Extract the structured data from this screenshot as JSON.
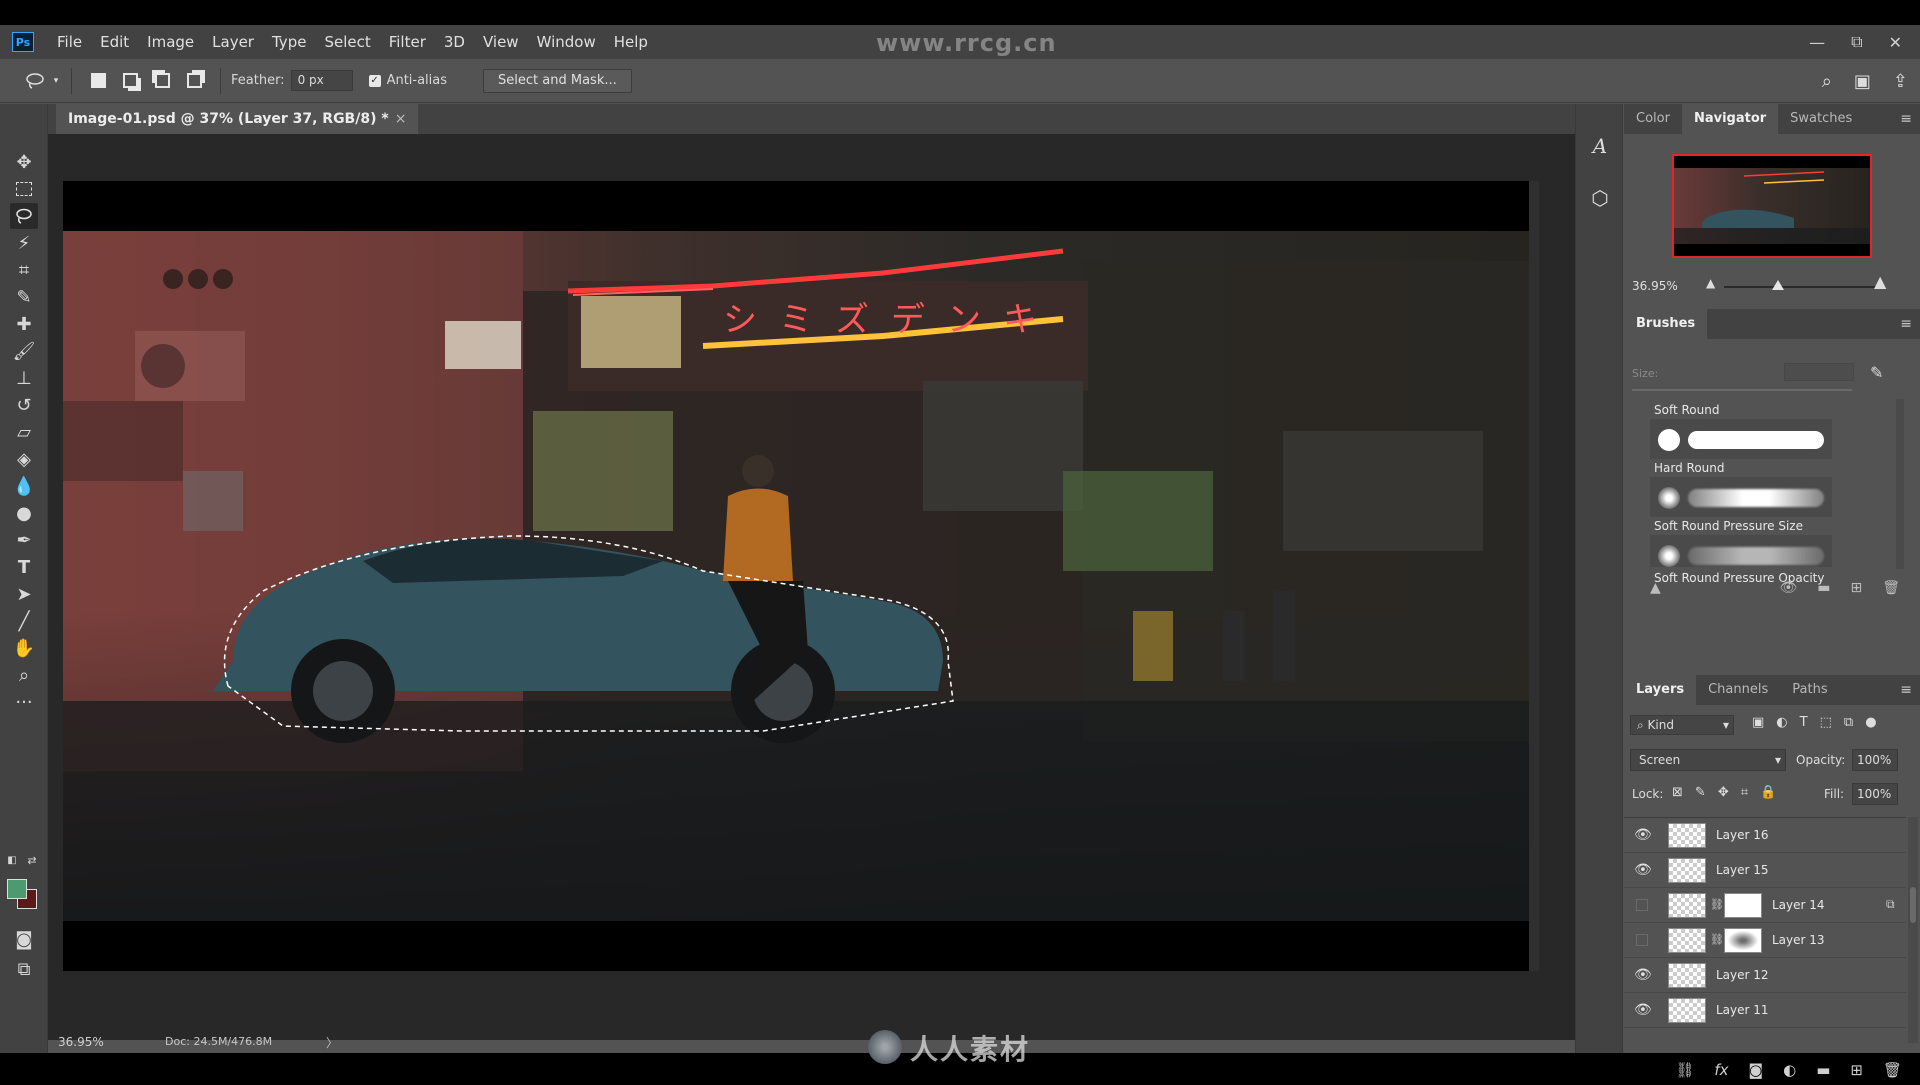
{
  "app": {
    "logo": "Ps",
    "watermark_top": "www.rrcg.cn",
    "watermark_bottom": "人人素材"
  },
  "menu": [
    "File",
    "Edit",
    "Image",
    "Layer",
    "Type",
    "Select",
    "Filter",
    "3D",
    "View",
    "Window",
    "Help"
  ],
  "window_controls": {
    "minimize": "—",
    "restore": "⧉",
    "close": "✕"
  },
  "options_bar": {
    "feather_label": "Feather:",
    "feather_value": "0 px",
    "anti_alias_label": "Anti-alias",
    "anti_alias_checked": true,
    "select_mask_label": "Select and Mask..."
  },
  "document": {
    "tab_title": "Image-01.psd @ 37% (Layer 37, RGB/8) *",
    "close_glyph": "×",
    "status_zoom": "36.95%",
    "status_doc": "Doc: 24.5M/476.8M",
    "status_arrow": "〉"
  },
  "tools": [
    "move-tool",
    "marquee-tool",
    "lasso-tool",
    "magic-wand-tool",
    "crop-tool",
    "eyedropper-tool",
    "healing-brush-tool",
    "brush-tool",
    "clone-stamp-tool",
    "history-brush-tool",
    "eraser-tool",
    "paint-bucket-tool",
    "dodge-tool",
    "burn-tool",
    "pen-tool",
    "type-tool",
    "path-selection-tool",
    "line-tool",
    "hand-tool",
    "zoom-tool",
    "more-tools"
  ],
  "colors": {
    "foreground": "#4c9a6e",
    "background": "#5a1a1a",
    "accent_thumb_border": "#e6232b"
  },
  "navigator_panel": {
    "tabs": [
      "Color",
      "Navigator",
      "Swatches"
    ],
    "active_tab": "Navigator",
    "zoom": "36.95%"
  },
  "brushes_panel": {
    "title": "Brushes",
    "size_label": "Size:",
    "items": [
      {
        "label": "Soft Round"
      },
      {
        "label": "Hard Round"
      },
      {
        "label": "Soft Round Pressure Size"
      },
      {
        "label": "Soft Round Pressure Opacity"
      }
    ]
  },
  "layers_panel": {
    "tabs": [
      "Layers",
      "Channels",
      "Paths"
    ],
    "active_tab": "Layers",
    "filter_kind": "Kind",
    "blend_mode": "Screen",
    "opacity_label": "Opacity:",
    "opacity_value": "100%",
    "lock_label": "Lock:",
    "fill_label": "Fill:",
    "fill_value": "100%",
    "layers": [
      {
        "name": "Layer 16",
        "visible": true,
        "has_mask": false
      },
      {
        "name": "Layer 15",
        "visible": true,
        "has_mask": false
      },
      {
        "name": "Layer 14",
        "visible": false,
        "has_mask": true
      },
      {
        "name": "Layer 13",
        "visible": false,
        "has_mask": true
      },
      {
        "name": "Layer 12",
        "visible": true,
        "has_mask": false
      },
      {
        "name": "Layer 11",
        "visible": true,
        "has_mask": false
      }
    ]
  }
}
